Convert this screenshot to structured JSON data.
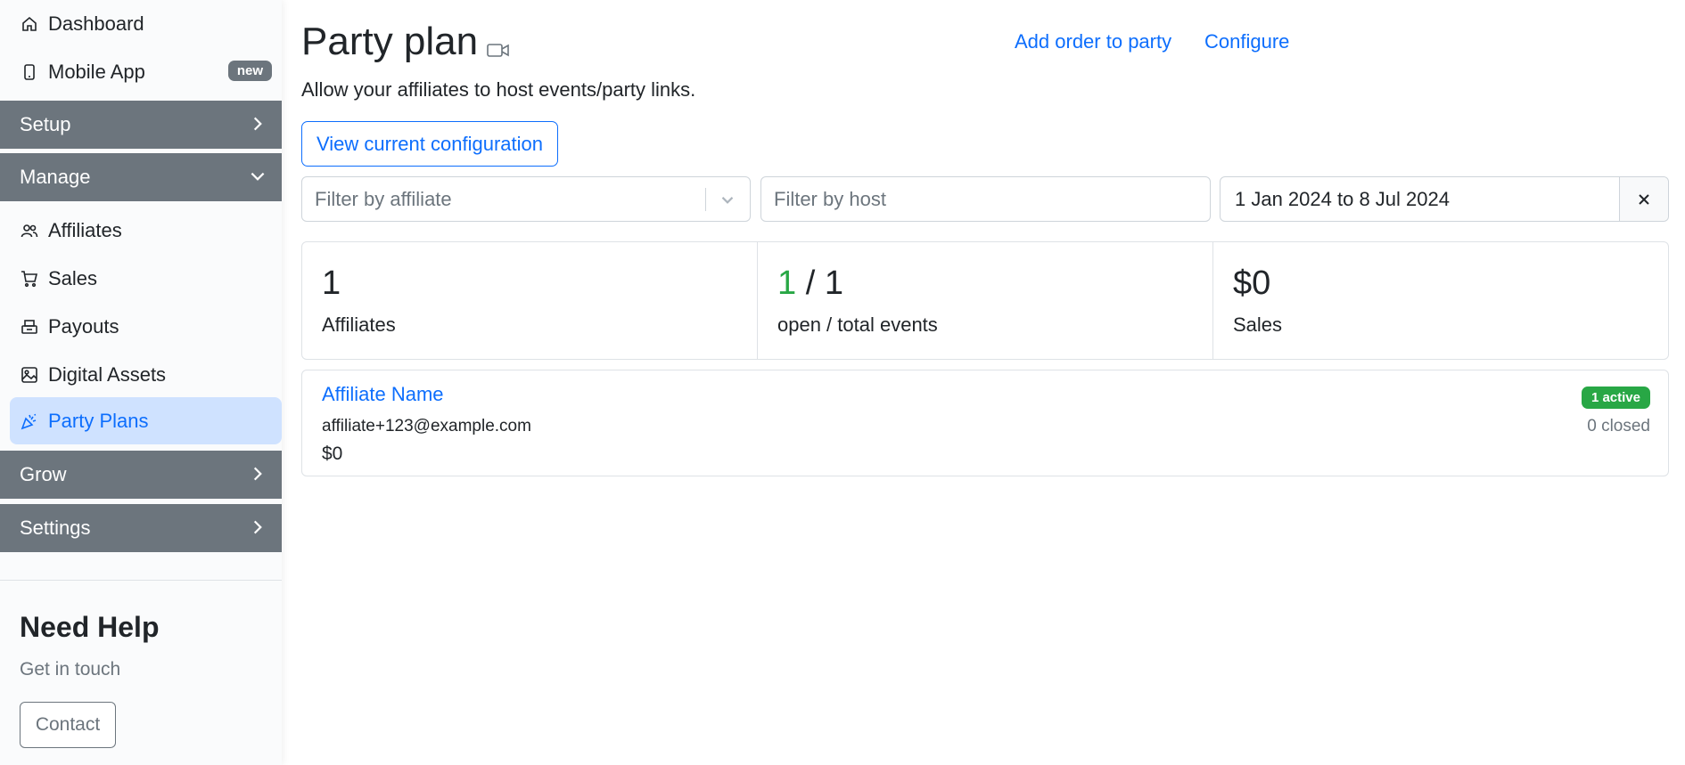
{
  "sidebar": {
    "items_top": [
      {
        "label": "Dashboard",
        "icon": "home-icon"
      },
      {
        "label": "Mobile App",
        "icon": "mobile-phone-icon",
        "badge": "new"
      }
    ],
    "sections": {
      "setup": "Setup",
      "manage": "Manage",
      "grow": "Grow",
      "settings": "Settings"
    },
    "manage_items": [
      {
        "label": "Affiliates",
        "icon": "people-icon"
      },
      {
        "label": "Sales",
        "icon": "cart-icon"
      },
      {
        "label": "Payouts",
        "icon": "cash-register-icon"
      },
      {
        "label": "Digital Assets",
        "icon": "image-icon"
      },
      {
        "label": "Party Plans",
        "icon": "party-popper-icon",
        "active": true
      }
    ],
    "help": {
      "title": "Need Help",
      "subtitle": "Get in touch",
      "contact_label": "Contact"
    }
  },
  "header": {
    "title": "Party plan",
    "video_icon": "video-camera-icon",
    "subtitle": "Allow your affiliates to host events/party links.",
    "add_order_label": "Add order to party",
    "configure_label": "Configure"
  },
  "actions": {
    "view_config_label": "View current configuration"
  },
  "filters": {
    "affiliate_placeholder": "Filter by affiliate",
    "host_placeholder": "Filter by host",
    "date_range": "1 Jan 2024 to 8 Jul 2024"
  },
  "stats": {
    "affiliates_value": "1",
    "affiliates_label": "Affiliates",
    "open_events": "1",
    "total_events_text": " / 1",
    "events_label": "open / total events",
    "sales_value": "$0",
    "sales_label": "Sales"
  },
  "party": {
    "affiliate_name": "Affiliate Name",
    "email": "affiliate+123@example.com",
    "amount": "$0",
    "active_badge": "1 active",
    "closed_text": "0 closed"
  },
  "colors": {
    "primary": "#0d6efd",
    "section_bg": "#6c757d",
    "active_bg": "#cfe2ff",
    "success": "#28a745"
  }
}
